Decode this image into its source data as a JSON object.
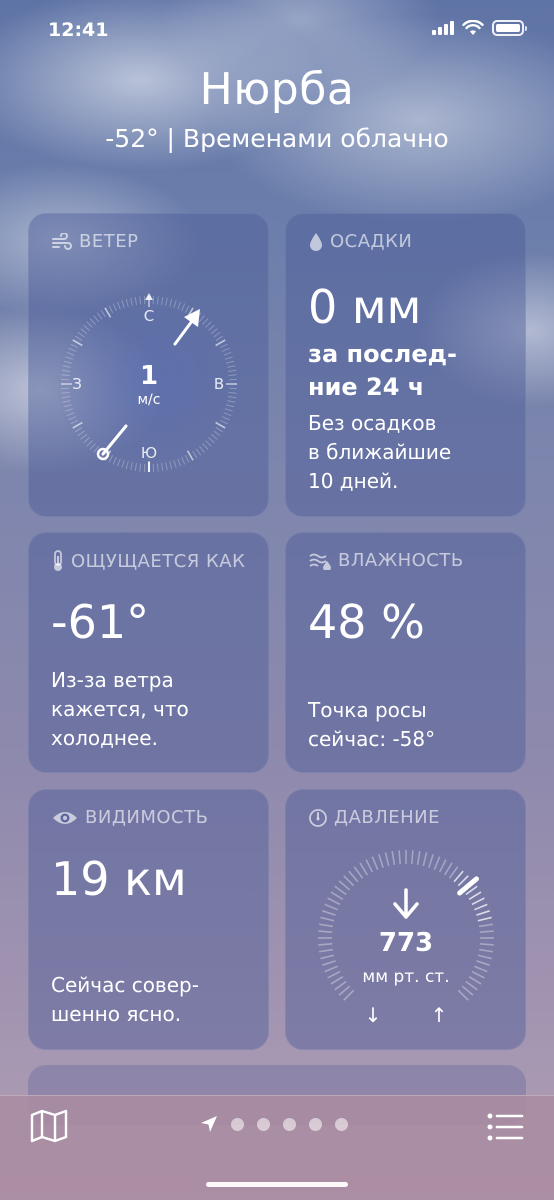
{
  "status_bar": {
    "time": "12:41"
  },
  "header": {
    "city": "Нюрба",
    "summary": "-52° | Временами облачно"
  },
  "wind": {
    "title": "ВЕТЕР",
    "speed": "1",
    "unit": "м/с",
    "directions": {
      "n": "С",
      "s": "Ю",
      "e": "В",
      "w": "З"
    }
  },
  "precipitation": {
    "title": "ОСАДКИ",
    "value": "0 мм",
    "period_line1": "за послед-",
    "period_line2": "ние 24 ч",
    "desc_line1": "Без осадков",
    "desc_line2": "в ближайшие",
    "desc_line3": "10 дней."
  },
  "feels_like": {
    "title": "ОЩУЩАЕТСЯ КАК",
    "value": "-61°",
    "desc_line1": "Из-за ветра",
    "desc_line2": "кажется, что",
    "desc_line3": "холоднее."
  },
  "humidity": {
    "title": "ВЛАЖНОСТЬ",
    "value": "48 %",
    "desc_line1": "Точка росы",
    "desc_line2": "сейчас: -58°"
  },
  "visibility": {
    "title": "ВИДИМОСТЬ",
    "value": "19 км",
    "desc_line1": "Сейчас совер-",
    "desc_line2": "шенно ясно."
  },
  "pressure": {
    "title": "ДАВЛЕНИЕ",
    "value": "773",
    "unit": "мм рт. ст.",
    "low_arrow": "↓",
    "high_arrow": "↑"
  },
  "tab_bar": {
    "page_count": 5
  }
}
